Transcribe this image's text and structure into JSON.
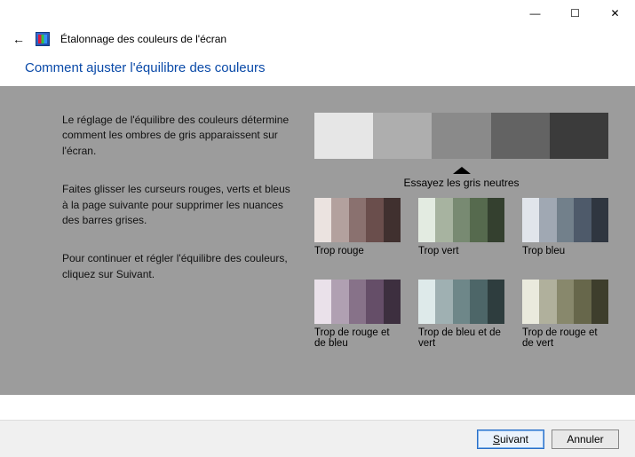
{
  "window": {
    "title": "Étalonnage des couleurs de l'écran",
    "min": "—",
    "max": "☐",
    "close": "✕",
    "back": "←"
  },
  "headline": "Comment ajuster l'équilibre des couleurs",
  "paragraphs": {
    "p1": "Le réglage de l'équilibre des couleurs détermine comment les ombres de gris apparaissent sur l'écran.",
    "p2": "Faites glisser les curseurs rouges, verts et bleus à la page suivante pour supprimer les nuances des barres grises.",
    "p3": "Pour continuer et régler l'équilibre des couleurs, cliquez sur Suivant."
  },
  "neutral_label": "Essayez les gris neutres",
  "gray_swatches": [
    "#e6e6e6",
    "#aeaeae",
    "#8a8a8a",
    "#636363",
    "#3b3b3b"
  ],
  "samples": [
    {
      "label": "Trop rouge",
      "colors": [
        "#ebe3e0",
        "#b3a19e",
        "#8a716f",
        "#6a4e4c",
        "#40302f"
      ]
    },
    {
      "label": "Trop vert",
      "colors": [
        "#e3ebe1",
        "#a7b3a0",
        "#788a72",
        "#566a4e",
        "#34402f"
      ]
    },
    {
      "label": "Trop bleu",
      "colors": [
        "#e1e5eb",
        "#a0a8b3",
        "#72808b",
        "#4e5a6a",
        "#2f3640"
      ]
    },
    {
      "label": "Trop de rouge et de bleu",
      "colors": [
        "#eae1ea",
        "#b0a0b2",
        "#877289",
        "#654e68",
        "#3d2f3f"
      ]
    },
    {
      "label": "Trop de bleu et de vert",
      "colors": [
        "#deeaea",
        "#9fb0b2",
        "#6e8789",
        "#4d6668",
        "#2e3d3e"
      ]
    },
    {
      "label": "Trop de rouge et de vert",
      "colors": [
        "#eaeadd",
        "#b0b09c",
        "#88886c",
        "#67674b",
        "#3e3e2c"
      ]
    }
  ],
  "buttons": {
    "next_u": "S",
    "next_rest": "uivant",
    "cancel": "Annuler"
  }
}
